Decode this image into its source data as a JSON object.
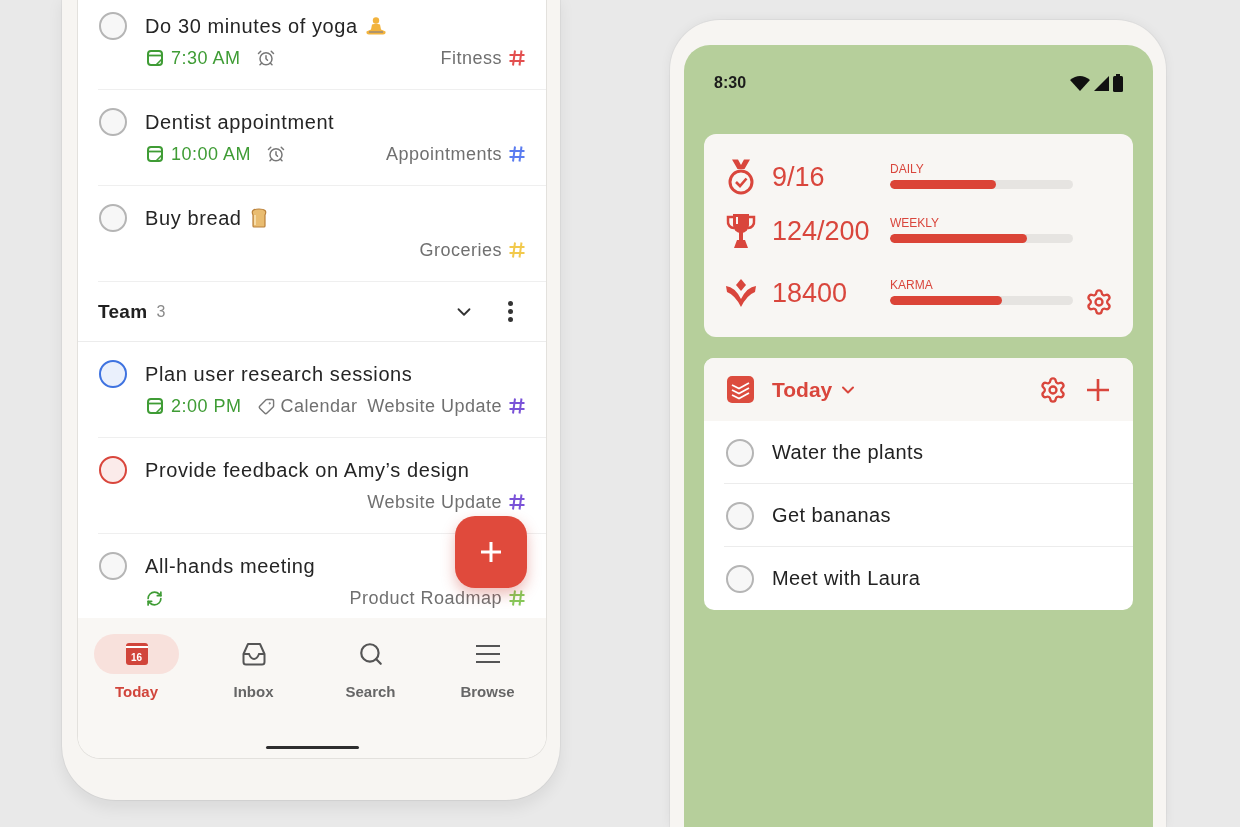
{
  "tasks": [
    {
      "title": "Do 30 minutes of yoga",
      "kind": "meditation",
      "checked": false,
      "color": "#b5b5b5",
      "time": "7:30 AM",
      "reminder": true,
      "recurring": false,
      "project": {
        "name": "Fitness",
        "color": "#e34f4f"
      }
    },
    {
      "title": "Dentist appointment",
      "checked": false,
      "color": "#b5b5b5",
      "time": "10:00 AM",
      "reminder": true,
      "recurring": false,
      "project": {
        "name": "Appointments",
        "color": "#5a7cf0"
      }
    },
    {
      "title": "Buy bread",
      "kind": "bread",
      "checked": false,
      "color": "#b5b5b5",
      "reminder": false,
      "recurring": false,
      "project": {
        "name": "Groceries",
        "color": "#f2c94c"
      }
    }
  ],
  "team_section": {
    "title": "Team",
    "count": "3",
    "expanded": true,
    "tasks": [
      {
        "title": "Plan user research sessions",
        "checked": false,
        "color": "#3f73e0",
        "time": "2:00 PM",
        "label": "Calendar",
        "reminder": false,
        "recurring": false,
        "project": {
          "name": "Website Update",
          "color": "#7a52d8"
        }
      },
      {
        "title": "Provide feedback on Amy’s design",
        "checked": false,
        "color": "#d9463c",
        "reminder": false,
        "recurring": false,
        "project": {
          "name": "Website Update",
          "color": "#7a52d8"
        }
      },
      {
        "title": "All-hands meeting",
        "checked": false,
        "color": "#b5b5b5",
        "reminder": false,
        "recurring": true,
        "project": {
          "name": "Product Roadmap",
          "color": "#86c95a"
        }
      }
    ]
  },
  "bottom_nav": [
    {
      "label": "Today",
      "kind": "today",
      "icon_text": "16",
      "selected": true
    },
    {
      "label": "Inbox",
      "kind": "inbox",
      "selected": false
    },
    {
      "label": "Search",
      "kind": "search",
      "selected": false
    },
    {
      "label": "Browse",
      "kind": "browse",
      "selected": false
    }
  ],
  "widget_phone": {
    "status_bar": {
      "time": "8:30"
    },
    "stats": [
      {
        "kind": "daily",
        "value": "9/16",
        "label": "DAILY",
        "level": 0.58
      },
      {
        "kind": "weekly",
        "value": "124/200",
        "label": "WEEKLY",
        "level": 0.75
      },
      {
        "kind": "karma",
        "value": "18400",
        "label": "KARMA",
        "level": 0.61
      }
    ],
    "today_widget": {
      "title": "Today",
      "tasks": [
        {
          "title": "Water the plants",
          "checked": false
        },
        {
          "title": "Get bananas",
          "checked": false
        },
        {
          "title": "Meet with Laura",
          "checked": false
        }
      ]
    }
  }
}
